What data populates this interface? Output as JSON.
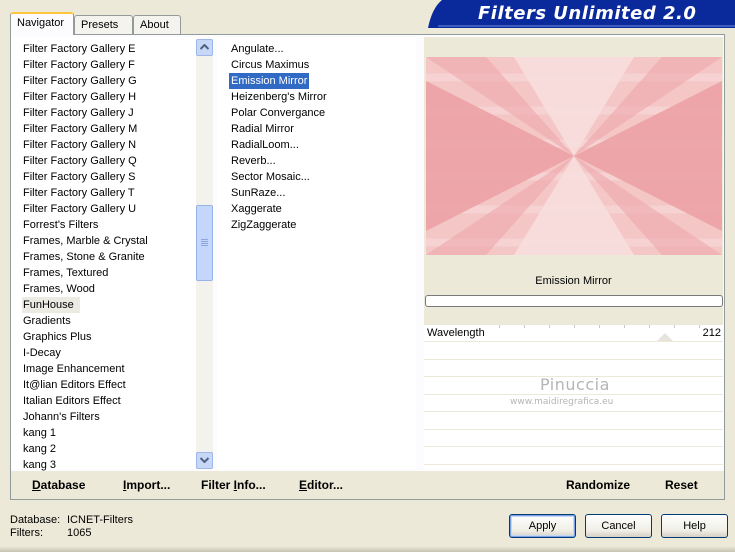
{
  "tabs": [
    {
      "label": "Navigator",
      "active": true
    },
    {
      "label": "Presets",
      "active": false
    },
    {
      "label": "About",
      "active": false
    }
  ],
  "banner": {
    "title": "Filters Unlimited 2.0",
    "color": "#0a2a9c"
  },
  "categories": {
    "items": [
      "Filter Factory Gallery E",
      "Filter Factory Gallery F",
      "Filter Factory Gallery G",
      "Filter Factory Gallery H",
      "Filter Factory Gallery J",
      "Filter Factory Gallery M",
      "Filter Factory Gallery N",
      "Filter Factory Gallery Q",
      "Filter Factory Gallery S",
      "Filter Factory Gallery T",
      "Filter Factory Gallery U",
      "Forrest's Filters",
      "Frames, Marble & Crystal",
      "Frames, Stone & Granite",
      "Frames, Textured",
      "Frames, Wood",
      "FunHouse",
      "Gradients",
      "Graphics Plus",
      "I-Decay",
      "Image Enhancement",
      "It@lian Editors Effect",
      "Italian Editors Effect",
      "Johann's Filters",
      "kang 1",
      "kang 2",
      "kang 3"
    ],
    "selected": "FunHouse"
  },
  "filters": {
    "items": [
      "Angulate...",
      "Circus Maximus",
      "Emission Mirror",
      "Heizenberg's Mirror",
      "Polar Convergance",
      "Radial Mirror",
      "RadialLoom...",
      "Reverb...",
      "Sector Mosaic...",
      "SunRaze...",
      "Xaggerate",
      "ZigZaggerate"
    ],
    "selected": "Emission Mirror",
    "selected_color": "#316ac5"
  },
  "preview": {
    "filter_name": "Emission Mirror",
    "colors": {
      "base": "#f4c6c6",
      "dark": "#eb9ca1",
      "light": "#f8dede"
    }
  },
  "sliders": [
    {
      "label": "Wavelength",
      "value": "212",
      "fraction": 0.831
    }
  ],
  "watermark": {
    "name": "Pinuccia",
    "url": "www.maidiregrafica.eu"
  },
  "toolbar": {
    "database": {
      "first": "D",
      "rest": "atabase"
    },
    "import": {
      "first": "I",
      "rest": "mport..."
    },
    "filter_info": {
      "label": "Filter ",
      "underline": "I",
      "rest": "nfo..."
    },
    "editor": {
      "first": "E",
      "rest": "ditor..."
    },
    "randomize": "Randomize",
    "reset": "Reset"
  },
  "status": {
    "database_label": "Database:",
    "database_value": "ICNET-Filters",
    "filters_label": "Filters:",
    "filters_value": "1065"
  },
  "buttons": {
    "apply": "Apply",
    "cancel": "Cancel",
    "help": "Help"
  }
}
